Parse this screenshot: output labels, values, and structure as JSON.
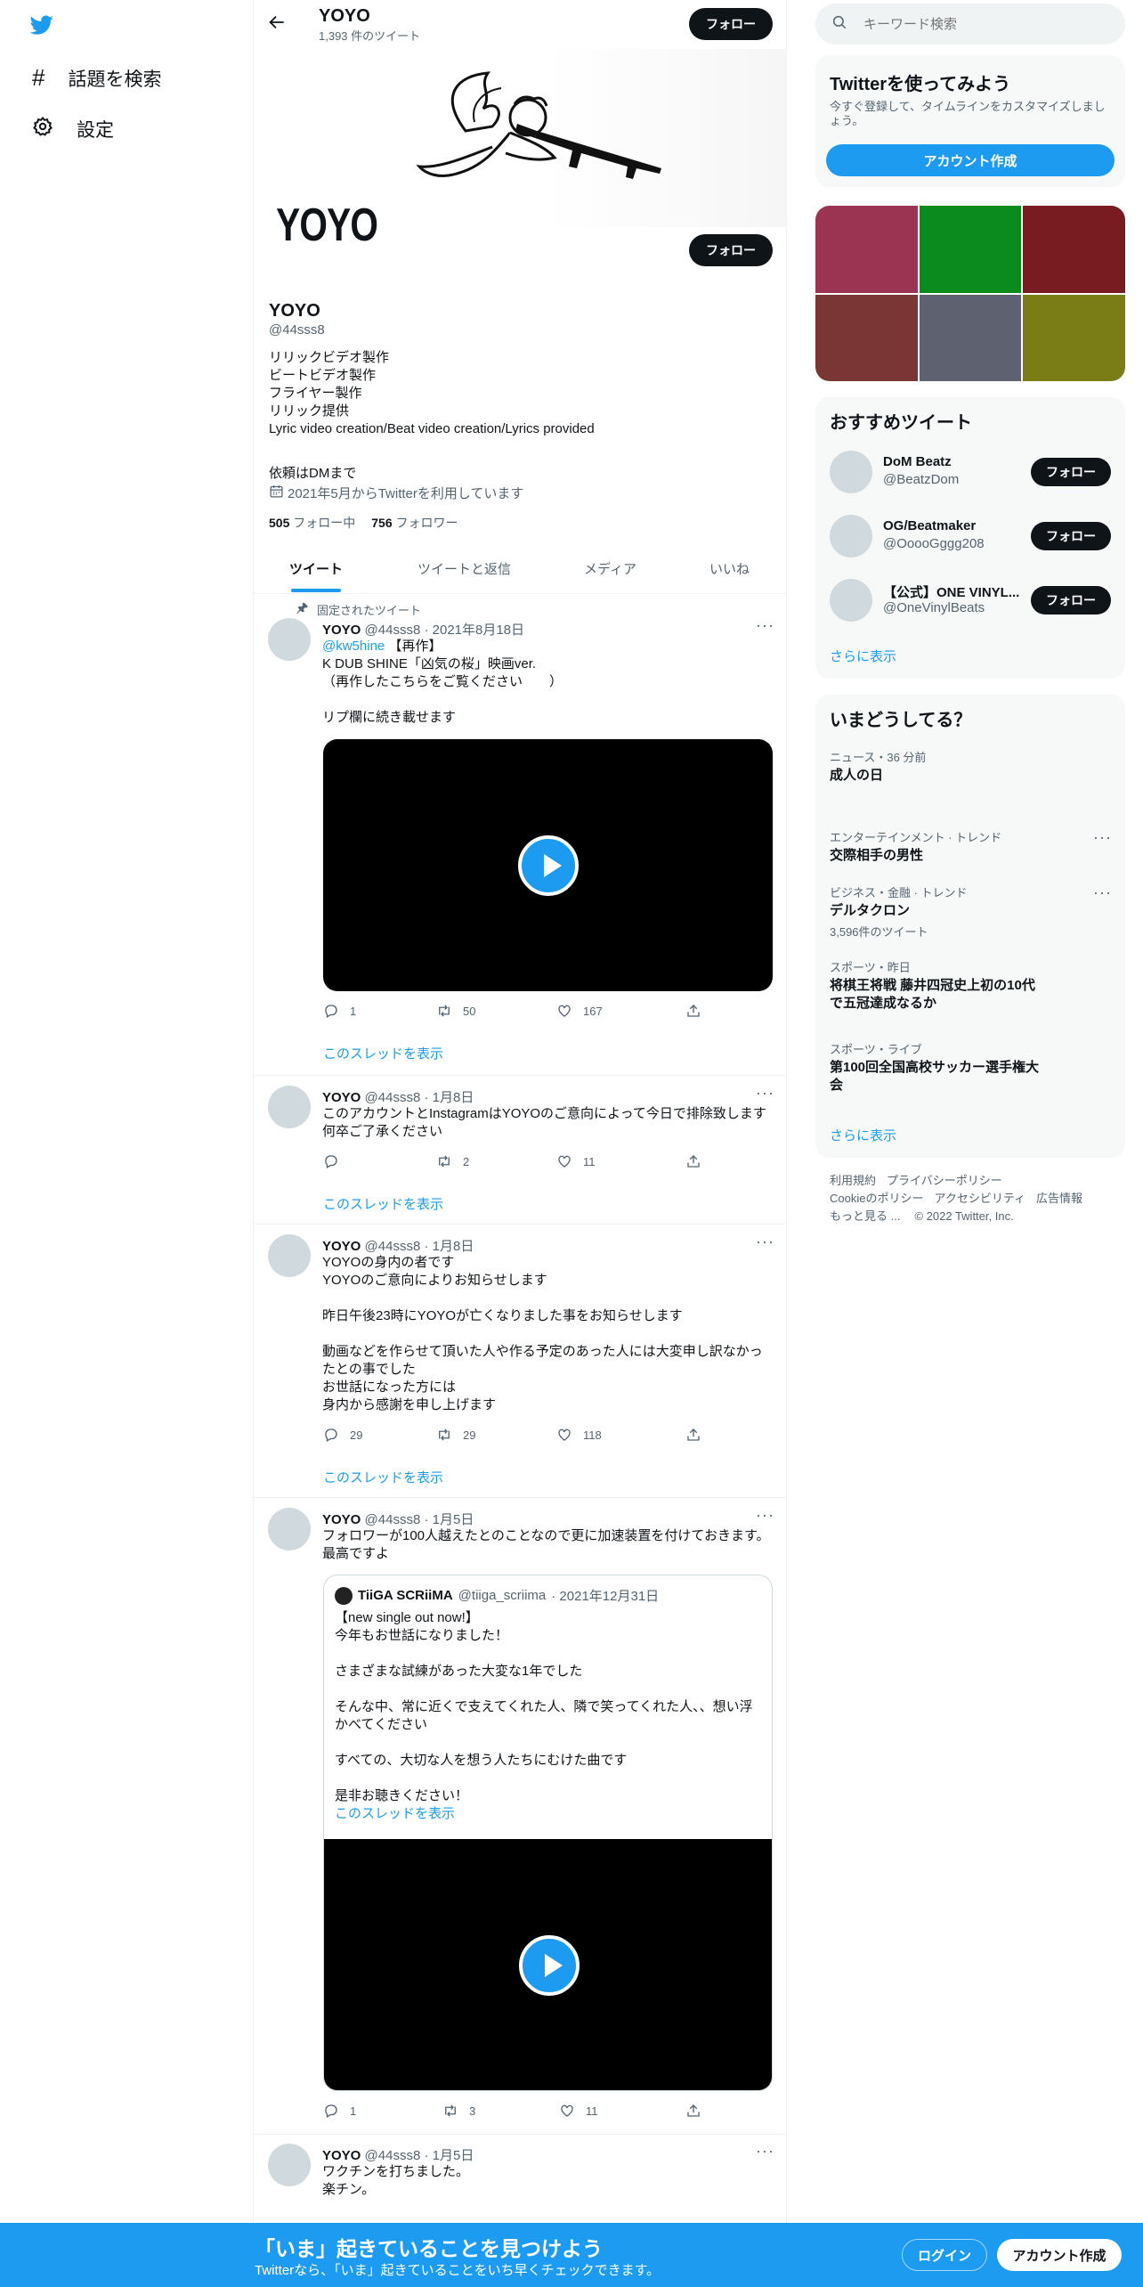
{
  "nav": {
    "explore_label": "話題を検索",
    "settings_label": "設定"
  },
  "header": {
    "name": "YOYO",
    "tweet_count": "1,393 件のツイート",
    "follow_label": "フォロー"
  },
  "profile": {
    "banner_wordmark": "YOYO",
    "follow_label": "フォロー",
    "name": "YOYO",
    "handle": "@44sss8",
    "bio_lines": [
      "リリックビデオ製作",
      "ビートビデオ製作",
      "フライヤー製作",
      "リリック提供",
      "Lyric video creation/Beat video creation/Lyrics provided",
      "",
      "依頼はDMまで"
    ],
    "joined": "2021年5月からTwitterを利用しています",
    "following_count": "505",
    "following_label": "フォロー中",
    "followers_count": "756",
    "followers_label": "フォロワー"
  },
  "tabs": [
    "ツイート",
    "ツイートと返信",
    "メディア",
    "いいね"
  ],
  "tweets": [
    {
      "pinned_label": "固定されたツイート",
      "name": "YOYO",
      "handle": "@44sss8",
      "date": "· 2021年8月18日",
      "mention": "@kw5hine",
      "mention_suffix": " 【再作】",
      "lines": [
        "K DUB SHINE「凶気の桜」映画ver.",
        "（再作したこちらをご覧ください　　）",
        "",
        "リプ欄に続き載せます"
      ],
      "reply": "1",
      "retweet": "50",
      "like": "167",
      "thread_label": "このスレッドを表示"
    },
    {
      "name": "YOYO",
      "handle": "@44sss8",
      "date": "· 1月8日",
      "lines": [
        "このアカウントとInstagramはYOYOのご意向によって今日で排除致します",
        "何卒ご了承ください"
      ],
      "reply": "",
      "retweet": "2",
      "like": "11",
      "thread_label": "このスレッドを表示"
    },
    {
      "name": "YOYO",
      "handle": "@44sss8",
      "date": "· 1月8日",
      "lines": [
        "YOYOの身内の者です",
        "YOYOのご意向によりお知らせします",
        "",
        "昨日午後23時にYOYOが亡くなりました事をお知らせします",
        "",
        "動画などを作らせて頂いた人や作る予定のあった人には大変申し訳なかっ",
        "たとの事でした",
        "お世話になった方には",
        "身内から感謝を申し上げます"
      ],
      "reply": "29",
      "retweet": "29",
      "like": "118",
      "thread_label": "このスレッドを表示"
    },
    {
      "name": "YOYO",
      "handle": "@44sss8",
      "date": "· 1月5日",
      "lines": [
        "フォロワーが100人越えたとのことなので更に加速装置を付けておきます。",
        "最高ですよ"
      ],
      "quote": {
        "name": "TiiGA SCRiiMA",
        "handle": "@tiiga_scriima",
        "date": "· 2021年12月31日",
        "lines": [
          "【new single out now!】",
          "今年もお世話になりました！",
          "",
          "さまざまな試練があった大変な1年でした",
          "",
          "そんな中、常に近くで支えてくれた人、隣で笑ってくれた人、、想い浮",
          "かべてください",
          "",
          "すべての、大切な人を想う人たちにむけた曲です",
          "",
          "是非お聴きください！"
        ],
        "thread_label": "このスレッドを表示"
      },
      "reply": "1",
      "retweet": "3",
      "like": "11"
    },
    {
      "name": "YOYO",
      "handle": "@44sss8",
      "date": "· 1月5日",
      "lines": [
        "ワクチンを打ちました。",
        "楽チン。",
        "",
        ""
      ]
    }
  ],
  "search": {
    "placeholder": "キーワード検索"
  },
  "signup_card": {
    "title": "Twitterを使ってみよう",
    "desc_line1": "今すぐ登録して、タイムラインをカスタマイズしまし",
    "desc_line2": "ょう。",
    "button_label": "アカウント作成"
  },
  "media_grid_colors": [
    "#9b3452",
    "#0b8a1d",
    "#781c22",
    "#7a3535",
    "#5e6170",
    "#7a7c15"
  ],
  "who_to_follow": {
    "title": "おすすめツイート",
    "accounts": [
      {
        "name": "DoM Beatz",
        "handle": "@BeatzDom",
        "button": "フォロー"
      },
      {
        "name": "OG/Beatmaker",
        "handle": "@OoooGggg208",
        "button": "フォロー"
      },
      {
        "name": "【公式】ONE VINYL...",
        "handle": "@OneVinylBeats",
        "button": "フォロー"
      }
    ],
    "more_label": "さらに表示"
  },
  "trends": {
    "title": "いまどうしてる？",
    "items": [
      {
        "category": "ニュース・36 分前",
        "name_lines": [
          "成人の日"
        ],
        "count": ""
      },
      {
        "category": "エンターテインメント · トレンド",
        "name_lines": [
          "交際相手の男性"
        ],
        "count": ""
      },
      {
        "category": "ビジネス・金融 · トレンド",
        "name_lines": [
          "デルタクロン"
        ],
        "count": "3,596件のツイート"
      },
      {
        "category": "スポーツ・昨日",
        "name_lines": [
          "将棋王将戦 藤井四冠史上初の10代",
          "で五冠達成なるか"
        ],
        "count": ""
      },
      {
        "category": "スポーツ・ライブ",
        "name_lines": [
          "第100回全国高校サッカー選手権大",
          "会"
        ],
        "count": ""
      }
    ],
    "more_label": "さらに表示"
  },
  "footer": {
    "row1": [
      "利用規約",
      "プライバシーポリシー"
    ],
    "row2": [
      "Cookieのポリシー",
      "アクセシビリティ",
      "広告情報"
    ],
    "row3": [
      "もっと見る ...",
      "© 2022 Twitter, Inc."
    ]
  },
  "bottom_bar": {
    "title": "「いま」起きていることを見つけよう",
    "subtitle": "Twitterなら、「いま」起きていることをいち早くチェックできます。",
    "login_label": "ログイン",
    "signup_label": "アカウント作成"
  },
  "colors": {
    "accent": "#1d9bf0",
    "text": "#0f1419",
    "muted": "#536471",
    "bottom_bar": "#1d9bf0"
  }
}
